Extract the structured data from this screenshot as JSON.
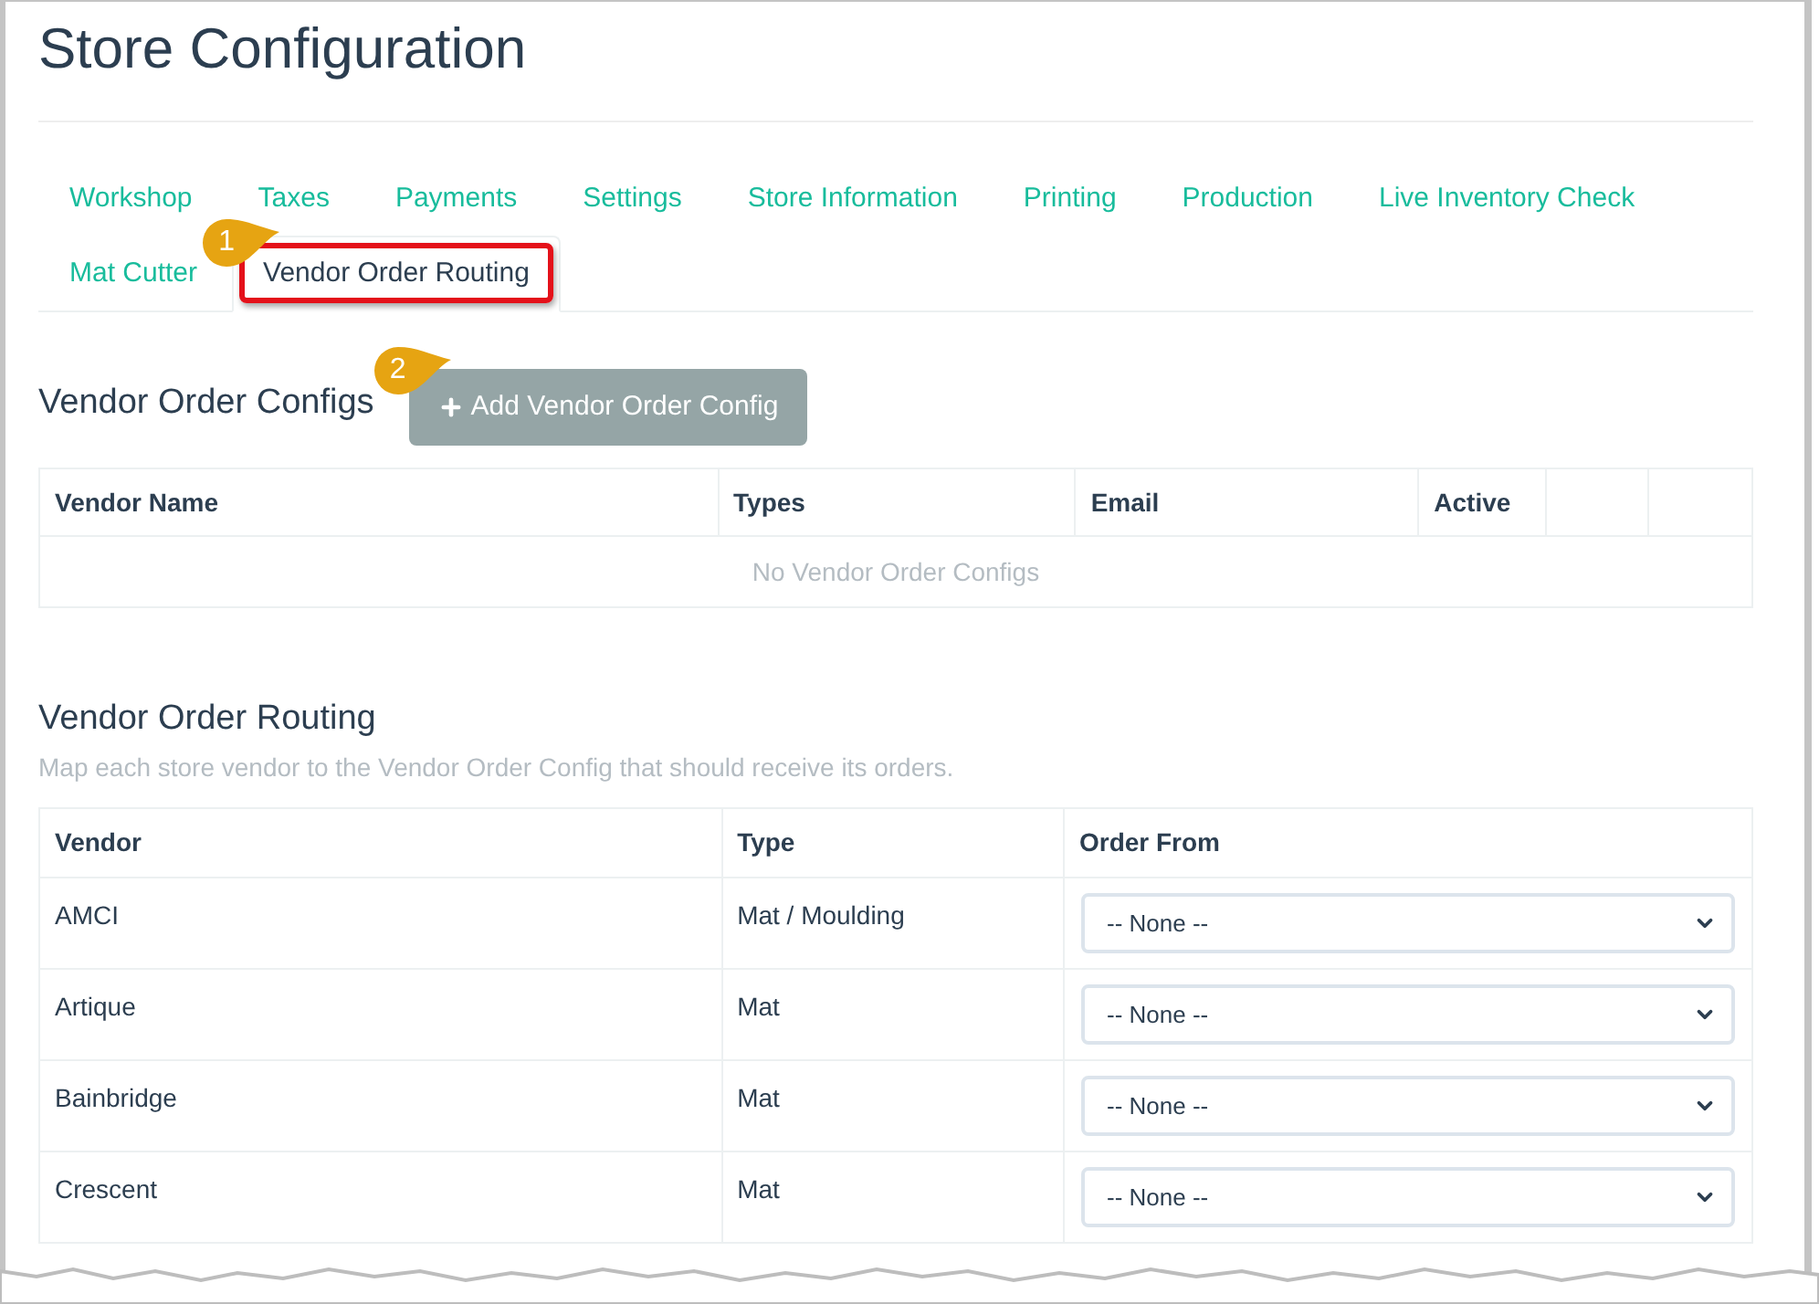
{
  "page": {
    "title": "Store Configuration"
  },
  "tabs": [
    {
      "label": "Workshop",
      "selected": false,
      "highlighted": false
    },
    {
      "label": "Taxes",
      "selected": false,
      "highlighted": false
    },
    {
      "label": "Payments",
      "selected": false,
      "highlighted": false
    },
    {
      "label": "Settings",
      "selected": false,
      "highlighted": false
    },
    {
      "label": "Store Information",
      "selected": false,
      "highlighted": false
    },
    {
      "label": "Printing",
      "selected": false,
      "highlighted": false
    },
    {
      "label": "Production",
      "selected": false,
      "highlighted": false
    },
    {
      "label": "Live Inventory Check",
      "selected": false,
      "highlighted": false
    },
    {
      "label": "Mat Cutter",
      "selected": false,
      "highlighted": false
    },
    {
      "label": "Vendor Order Routing",
      "selected": true,
      "highlighted": true,
      "callout": "1"
    }
  ],
  "vendor_order_configs": {
    "heading": "Vendor Order Configs",
    "add_button": {
      "label": "Add Vendor Order Config",
      "callout": "2"
    },
    "table": {
      "columns": [
        "Vendor Name",
        "Types",
        "Email",
        "Active"
      ],
      "empty_message": "No Vendor Order Configs"
    }
  },
  "vendor_order_routing": {
    "heading": "Vendor Order Routing",
    "description": "Map each store vendor to the Vendor Order Config that should receive its orders.",
    "table": {
      "columns": [
        "Vendor",
        "Type",
        "Order From"
      ],
      "rows": [
        {
          "vendor": "AMCI",
          "type": "Mat / Moulding",
          "order_from": "-- None --"
        },
        {
          "vendor": "Artique",
          "type": "Mat",
          "order_from": "-- None --"
        },
        {
          "vendor": "Bainbridge",
          "type": "Mat",
          "order_from": "-- None --"
        },
        {
          "vendor": "Crescent",
          "type": "Mat",
          "order_from": "-- None --"
        }
      ]
    }
  }
}
